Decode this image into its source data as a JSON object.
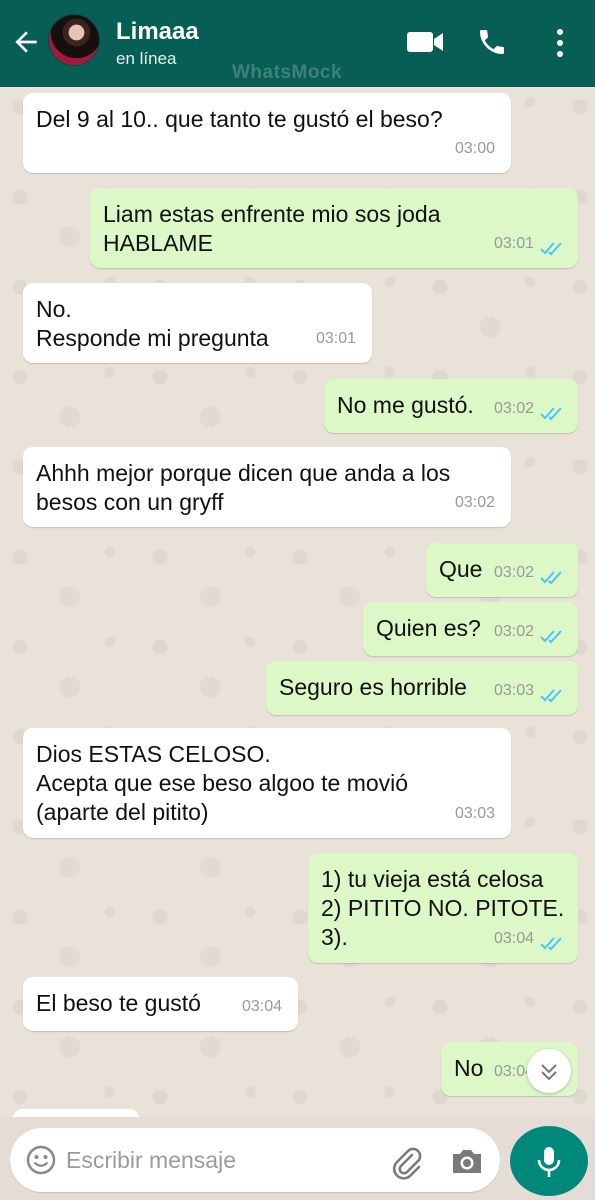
{
  "header": {
    "contact_name": "Limaaa",
    "status": "en línea",
    "watermark": "WhatsMock",
    "icons": [
      "back-arrow-icon",
      "avatar",
      "video-call-icon",
      "phone-call-icon",
      "more-vert-icon"
    ]
  },
  "messages": [
    {
      "dir": "in",
      "text": "Del 9 al 10.. que tanto te gustó el beso?",
      "time": "03:00"
    },
    {
      "dir": "out",
      "text": "Liam estas enfrente mio sos joda\nHABLAME",
      "time": "03:01",
      "read": true
    },
    {
      "dir": "in",
      "text": "No.\nResponde mi pregunta",
      "time": "03:01"
    },
    {
      "dir": "out",
      "text": "No me gustó.",
      "time": "03:02",
      "read": true
    },
    {
      "dir": "in",
      "text": "Ahhh mejor porque dicen que anda a los\nbesos con un gryff",
      "time": "03:02"
    },
    {
      "dir": "out",
      "text": "Que",
      "time": "03:02",
      "read": true
    },
    {
      "dir": "out",
      "text": "Quien es?",
      "time": "03:02",
      "read": true
    },
    {
      "dir": "out",
      "text": "Seguro es horrible",
      "time": "03:03",
      "read": true
    },
    {
      "dir": "in",
      "text": "Dios ESTAS CELOSO.\nAcepta que ese beso algoo te movió\n(aparte del pitito)",
      "time": "03:03"
    },
    {
      "dir": "out",
      "text": "1) tu vieja está celosa\n2) PITITO NO. PITOTE.\n3).",
      "time": "03:04",
      "read": true
    },
    {
      "dir": "in",
      "text": "El beso te gustó",
      "time": "03:04"
    },
    {
      "dir": "out",
      "text": "No",
      "time": "03:04",
      "read": true
    }
  ],
  "composer": {
    "placeholder": "Escribir mensaje",
    "icons": [
      "emoji-icon",
      "paperclip-icon",
      "camera-icon",
      "microphone-icon"
    ]
  },
  "colors": {
    "header": "#075e54",
    "outgoing_bubble": "#dcf8c6",
    "incoming_bubble": "#ffffff",
    "read_tick": "#4fc3f7",
    "mic_button": "#00897b"
  }
}
